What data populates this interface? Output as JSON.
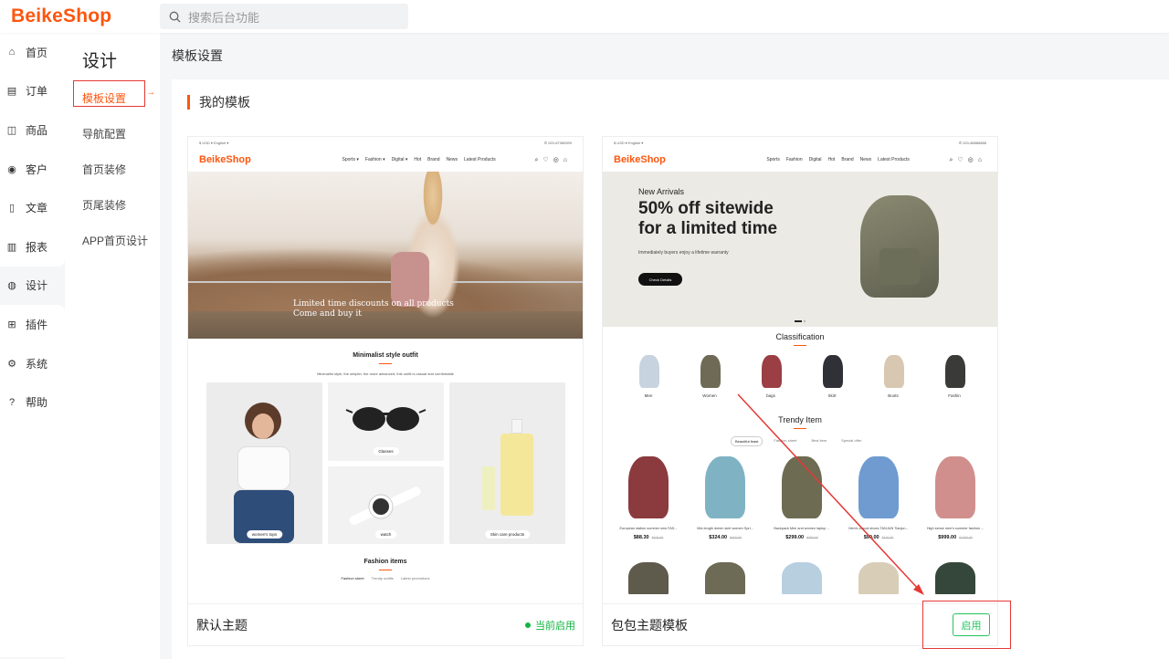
{
  "header": {
    "logo": "BeikeShop",
    "search_placeholder": "搜索后台功能"
  },
  "menu_primary": [
    {
      "label": "首页",
      "icon": "home-icon",
      "glyph": "⌂"
    },
    {
      "label": "订单",
      "icon": "order-icon",
      "glyph": "▤"
    },
    {
      "label": "商品",
      "icon": "product-icon",
      "glyph": "◫"
    },
    {
      "label": "客户",
      "icon": "customer-icon",
      "glyph": "◉"
    },
    {
      "label": "文章",
      "icon": "article-icon",
      "glyph": "▯"
    },
    {
      "label": "报表",
      "icon": "report-icon",
      "glyph": "▥"
    },
    {
      "label": "设计",
      "icon": "design-icon",
      "glyph": "◍"
    },
    {
      "label": "插件",
      "icon": "plugin-icon",
      "glyph": "⊞"
    },
    {
      "label": "系统",
      "icon": "system-icon",
      "glyph": "⚙"
    },
    {
      "label": "帮助",
      "icon": "help-icon",
      "glyph": "?"
    }
  ],
  "menu_secondary": {
    "title": "设计",
    "items": [
      "模板设置",
      "导航配置",
      "首页装修",
      "页尾装修",
      "APP首页设计"
    ]
  },
  "breadcrumb": "模板设置",
  "section_title": "我的模板",
  "templates": [
    {
      "name": "默认主题",
      "status": "当前启用",
      "preview": {
        "top_left": "$ USD ▾   English ▾",
        "top_right": "✆ 020-87980599",
        "logo": "BeikeShop",
        "nav": [
          "Sports ▾",
          "Fashion ▾",
          "Digital ▾",
          "Hot",
          "Brand",
          "News",
          "Latest Products"
        ],
        "hero_line1": "Limited time discounts on all products",
        "hero_line2": "Come and buy it",
        "section1_title": "Minimalist style outfit",
        "section1_sub": "Minimalist style, the simpler, the more advanced, this outfit is casual and comfortable",
        "tiles": [
          "women's tops",
          "Glasses",
          "watch",
          "Skin care products"
        ],
        "section2_title": "Fashion items",
        "section2_tabs": [
          "Fashion sheet",
          "Trendy outfits",
          "Latest promotions"
        ]
      }
    },
    {
      "name": "包包主题模板",
      "action": "启用",
      "preview": {
        "top_left": "$ USD ▾   English ▾",
        "top_right": "✆ 020-88888888",
        "logo": "BeikeShop",
        "nav": [
          "Sports",
          "Fashion",
          "Digital",
          "Hot",
          "Brand",
          "News",
          "Latest Products"
        ],
        "hero_small": "New Arrivals",
        "hero_big_1": "50% off sitewide",
        "hero_big_2": "for a limited time",
        "hero_note": "Immediately buyers enjoy a lifetime warranty",
        "hero_btn": "Check Details",
        "classification_title": "Classification",
        "categories": [
          "Men",
          "Women",
          "bags",
          "Skirt",
          "Boots",
          "Fashin"
        ],
        "trendy_title": "Trendy Item",
        "trendy_tabs": [
          "Beautiful feast",
          "Fashion sheet",
          "Best item",
          "Special offer"
        ],
        "products": [
          {
            "name": "European station summer new FAS...",
            "price": "$88.30",
            "old": "$100.00"
          },
          {
            "name": "Mid-length denim skirt women Spri...",
            "price": "$324.00",
            "old": "$400.00"
          },
          {
            "name": "Backpack Men and women laptop ...",
            "price": "$299.00",
            "old": "$350.00"
          },
          {
            "name": "Men's casual shoes TANJUN Tianjun...",
            "price": "$99.00",
            "old": "$120.00"
          },
          {
            "name": "High sense men's summer fashion ...",
            "price": "$999.00",
            "old": "$1200.00"
          }
        ]
      }
    }
  ],
  "colors": {
    "brand": "#fd560f",
    "success": "#11b541",
    "annotation": "#e53935"
  }
}
